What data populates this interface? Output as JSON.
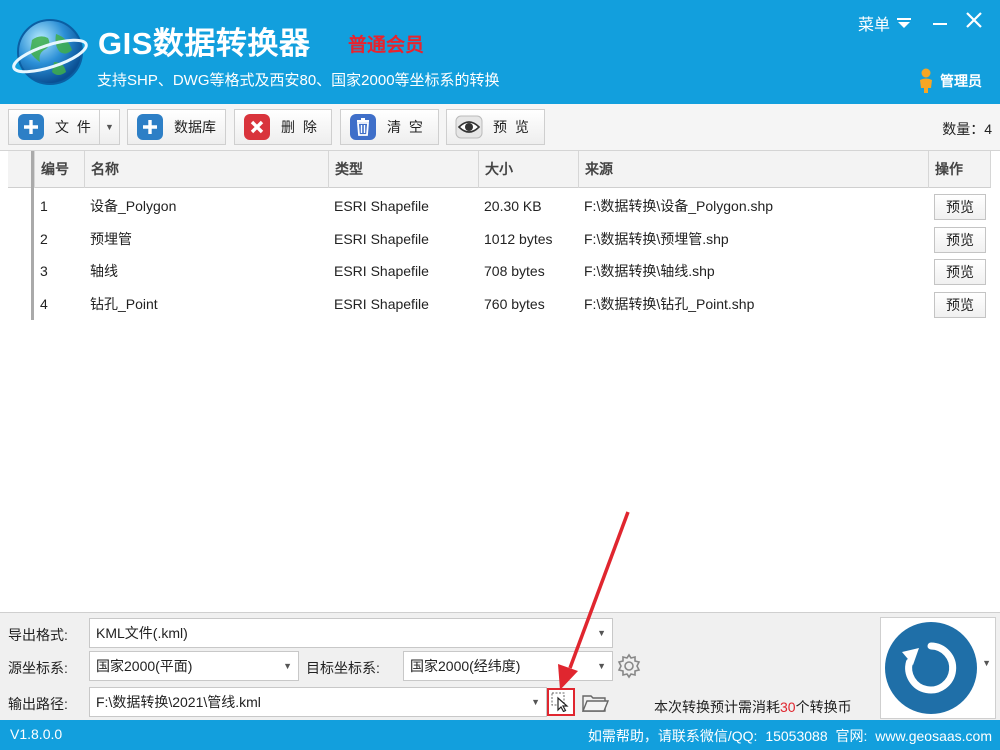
{
  "app": {
    "title": "GIS数据转换器",
    "member_level": "普通会员",
    "subtitle": "支持SHP、DWG等格式及西安80、国家2000等坐标系的转换",
    "menu_label": "菜单",
    "user_label": "管理员"
  },
  "toolbar": {
    "file_label": "文 件",
    "database_label": "数据库",
    "delete_label": "删 除",
    "clear_label": "清 空",
    "preview_label": "预 览",
    "count_text": "数量：4"
  },
  "table": {
    "columns": [
      "编号",
      "名称",
      "类型",
      "大小",
      "来源",
      "操作"
    ],
    "rows": [
      {
        "no": "1",
        "name": "设备_Polygon",
        "type": "ESRI Shapefile",
        "size": "20.30 KB",
        "source": "F:\\数据转换\\设备_Polygon.shp",
        "action": "预览"
      },
      {
        "no": "2",
        "name": "预埋管",
        "type": "ESRI Shapefile",
        "size": "1012 bytes",
        "source": "F:\\数据转换\\预埋管.shp",
        "action": "预览"
      },
      {
        "no": "3",
        "name": "轴线",
        "type": "ESRI Shapefile",
        "size": "708 bytes",
        "source": "F:\\数据转换\\轴线.shp",
        "action": "预览"
      },
      {
        "no": "4",
        "name": "钻孔_Point",
        "type": "ESRI Shapefile",
        "size": "760 bytes",
        "source": "F:\\数据转换\\钻孔_Point.shp",
        "action": "预览"
      }
    ]
  },
  "export": {
    "format_label": "导出格式:",
    "format_value": "KML文件(.kml)",
    "source_crs_label": "源坐标系:",
    "source_crs_value": "国家2000(平面)",
    "target_crs_label": "目标坐标系:",
    "target_crs_value": "国家2000(经纬度)",
    "output_label": "输出路径:",
    "output_value": "F:\\数据转换\\2021\\管线.kml",
    "cost_prefix": "本次转换预计需消耗",
    "cost_number": "30",
    "cost_suffix": "个转换币"
  },
  "status": {
    "version": "V1.8.0.0",
    "help": "如需帮助，请联系微信/QQ:  15053088  官网:  www.geosaas.com"
  },
  "colors": {
    "primary": "#129fdd",
    "accent_red": "#e0262f",
    "run_button": "#1f6fa8"
  },
  "icons": [
    "globe-logo-icon",
    "chevron-down-icon",
    "minimize-icon",
    "close-icon",
    "user-icon",
    "plus-icon",
    "delete-x-icon",
    "trash-icon",
    "eye-icon",
    "gear-icon",
    "select-pointer-icon",
    "folder-icon",
    "refresh-run-icon"
  ]
}
